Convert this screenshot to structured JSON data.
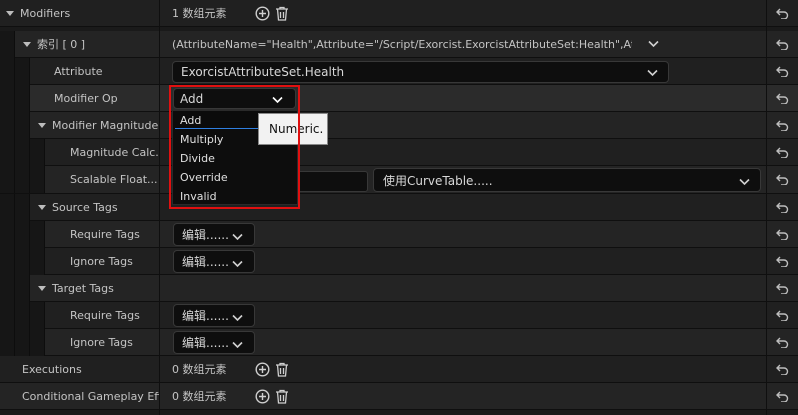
{
  "rows": {
    "modifiers": {
      "label": "Modifiers",
      "value": "1 数组元素"
    },
    "index": {
      "label": "索引 [ 0 ]",
      "value": "(AttributeName=\"Health\",Attribute=\"/Script/Exorcist.ExorcistAttributeSet:Health\",AttributeC"
    },
    "attribute": {
      "label": "Attribute",
      "value": "ExorcistAttributeSet.Health"
    },
    "modifier_op": {
      "label": "Modifier Op",
      "value": "Add"
    },
    "modifier_magnitude": {
      "label": "Modifier Magnitude"
    },
    "magnitude_calc": {
      "label": "Magnitude Calc..."
    },
    "scalable_float": {
      "label": "Scalable Float...",
      "curve_table": "使用CurveTable....."
    },
    "source_tags": {
      "label": "Source Tags"
    },
    "source_require": {
      "label": "Require Tags",
      "value": "编辑......"
    },
    "source_ignore": {
      "label": "Ignore Tags",
      "value": "编辑......"
    },
    "target_tags": {
      "label": "Target Tags"
    },
    "target_require": {
      "label": "Require Tags",
      "value": "编辑......"
    },
    "target_ignore": {
      "label": "Ignore Tags",
      "value": "编辑......"
    },
    "executions": {
      "label": "Executions",
      "value": "0 数组元素"
    },
    "conditional": {
      "label": "Conditional Gameplay Eff...",
      "value": "0 数组元素"
    }
  },
  "dropdown": {
    "options": [
      "Add",
      "Multiply",
      "Divide",
      "Override",
      "Invalid"
    ],
    "selected": "Add"
  },
  "tooltip": "Numeric.",
  "colors": {
    "highlight": "#e01010",
    "accent": "#2f7fe0"
  },
  "icons": [
    "expand-triangle-icon",
    "add-circle-icon",
    "trash-icon",
    "reset-arrow-icon",
    "chevron-down-icon"
  ]
}
